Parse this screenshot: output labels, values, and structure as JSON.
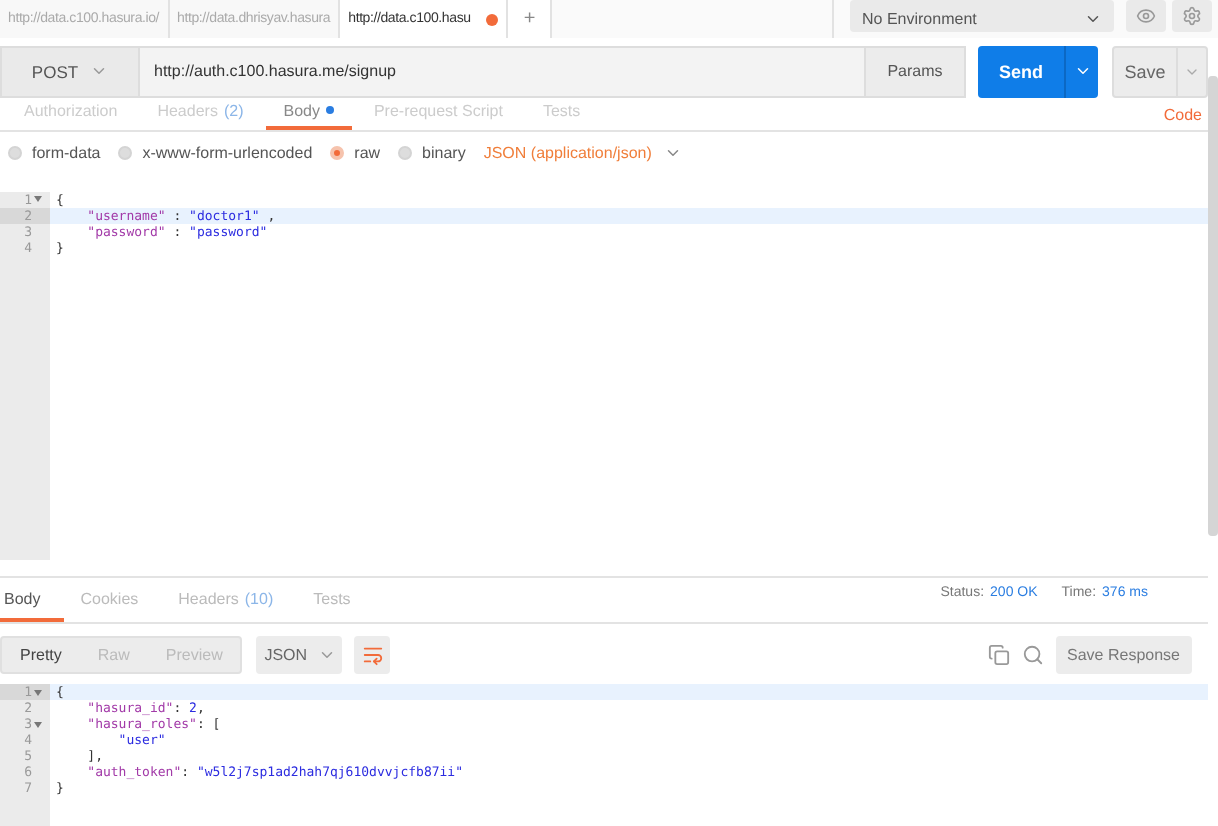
{
  "url_tabs": [
    {
      "label": "http://data.c100.hasura.io/",
      "selected": false,
      "unsaved": false
    },
    {
      "label": "http://data.dhrisyav.hasura",
      "selected": false,
      "unsaved": false
    },
    {
      "label": "http://data.c100.hasu",
      "selected": true,
      "unsaved": true
    }
  ],
  "new_tab": "+",
  "environment": "No Environment",
  "request": {
    "method": "POST",
    "url": "http://auth.c100.hasura.me/signup",
    "params": "Params",
    "send": "Send",
    "save": "Save"
  },
  "request_tabs": [
    {
      "label": "Authorization",
      "selected": false,
      "dot": false
    },
    {
      "label": "Headers",
      "count": "(2)",
      "selected": false,
      "dot": false
    },
    {
      "label": "Body",
      "selected": true,
      "dot": true
    },
    {
      "label": "Pre-request Script",
      "selected": false,
      "dot": false
    },
    {
      "label": "Tests",
      "selected": false,
      "dot": false
    }
  ],
  "code_link": "Code",
  "body_types": [
    {
      "label": "form-data",
      "selected": false
    },
    {
      "label": "x-www-form-urlencoded",
      "selected": false
    },
    {
      "label": "raw",
      "selected": true
    },
    {
      "label": "binary",
      "selected": false
    }
  ],
  "content_type": "JSON (application/json)",
  "request_body": [
    {
      "number": "1",
      "fold": true,
      "active": false,
      "tokens": [
        {
          "kind": "punct",
          "text": "{"
        }
      ]
    },
    {
      "number": "2",
      "fold": false,
      "active": true,
      "tokens": [
        {
          "kind": "key",
          "text": "    \"username\""
        },
        {
          "kind": "punct",
          "text": " : "
        },
        {
          "kind": "string",
          "text": "\"doctor1\""
        },
        {
          "kind": "punct",
          "text": " ,"
        }
      ]
    },
    {
      "number": "3",
      "fold": false,
      "active": false,
      "tokens": [
        {
          "kind": "key",
          "text": "    \"password\""
        },
        {
          "kind": "punct",
          "text": " : "
        },
        {
          "kind": "string",
          "text": "\"password\""
        }
      ]
    },
    {
      "number": "4",
      "fold": false,
      "active": false,
      "tokens": [
        {
          "kind": "punct",
          "text": "}"
        }
      ]
    }
  ],
  "response_tabs": [
    {
      "label": "Body",
      "selected": true
    },
    {
      "label": "Cookies",
      "selected": false
    },
    {
      "label": "Headers",
      "count": "(10)",
      "selected": false
    },
    {
      "label": "Tests",
      "selected": false
    }
  ],
  "status": {
    "label": "Status:",
    "value": "200 OK"
  },
  "time": {
    "label": "Time:",
    "value": "376 ms"
  },
  "view_modes": [
    {
      "label": "Pretty",
      "selected": true
    },
    {
      "label": "Raw",
      "selected": false
    },
    {
      "label": "Preview",
      "selected": false
    }
  ],
  "format": "JSON",
  "save_response": "Save Response",
  "response_body": [
    {
      "number": "1",
      "fold": true,
      "active": true,
      "tokens": [
        {
          "kind": "punct",
          "text": "{"
        }
      ]
    },
    {
      "number": "2",
      "fold": false,
      "active": false,
      "tokens": [
        {
          "kind": "key",
          "text": "    \"hasura_id\""
        },
        {
          "kind": "punct",
          "text": ": "
        },
        {
          "kind": "number",
          "text": "2"
        },
        {
          "kind": "punct",
          "text": ","
        }
      ]
    },
    {
      "number": "3",
      "fold": true,
      "active": false,
      "tokens": [
        {
          "kind": "key",
          "text": "    \"hasura_roles\""
        },
        {
          "kind": "punct",
          "text": ": ["
        }
      ]
    },
    {
      "number": "4",
      "fold": false,
      "active": false,
      "tokens": [
        {
          "kind": "string",
          "text": "        \"user\""
        }
      ]
    },
    {
      "number": "5",
      "fold": false,
      "active": false,
      "tokens": [
        {
          "kind": "punct",
          "text": "    ],"
        }
      ]
    },
    {
      "number": "6",
      "fold": false,
      "active": false,
      "tokens": [
        {
          "kind": "key",
          "text": "    \"auth_token\""
        },
        {
          "kind": "punct",
          "text": ": "
        },
        {
          "kind": "string",
          "text": "\"w5l2j7sp1ad2hah7qj610dvvjcfb87ii\""
        }
      ]
    },
    {
      "number": "7",
      "fold": false,
      "active": false,
      "tokens": [
        {
          "kind": "punct",
          "text": "}"
        }
      ]
    }
  ]
}
